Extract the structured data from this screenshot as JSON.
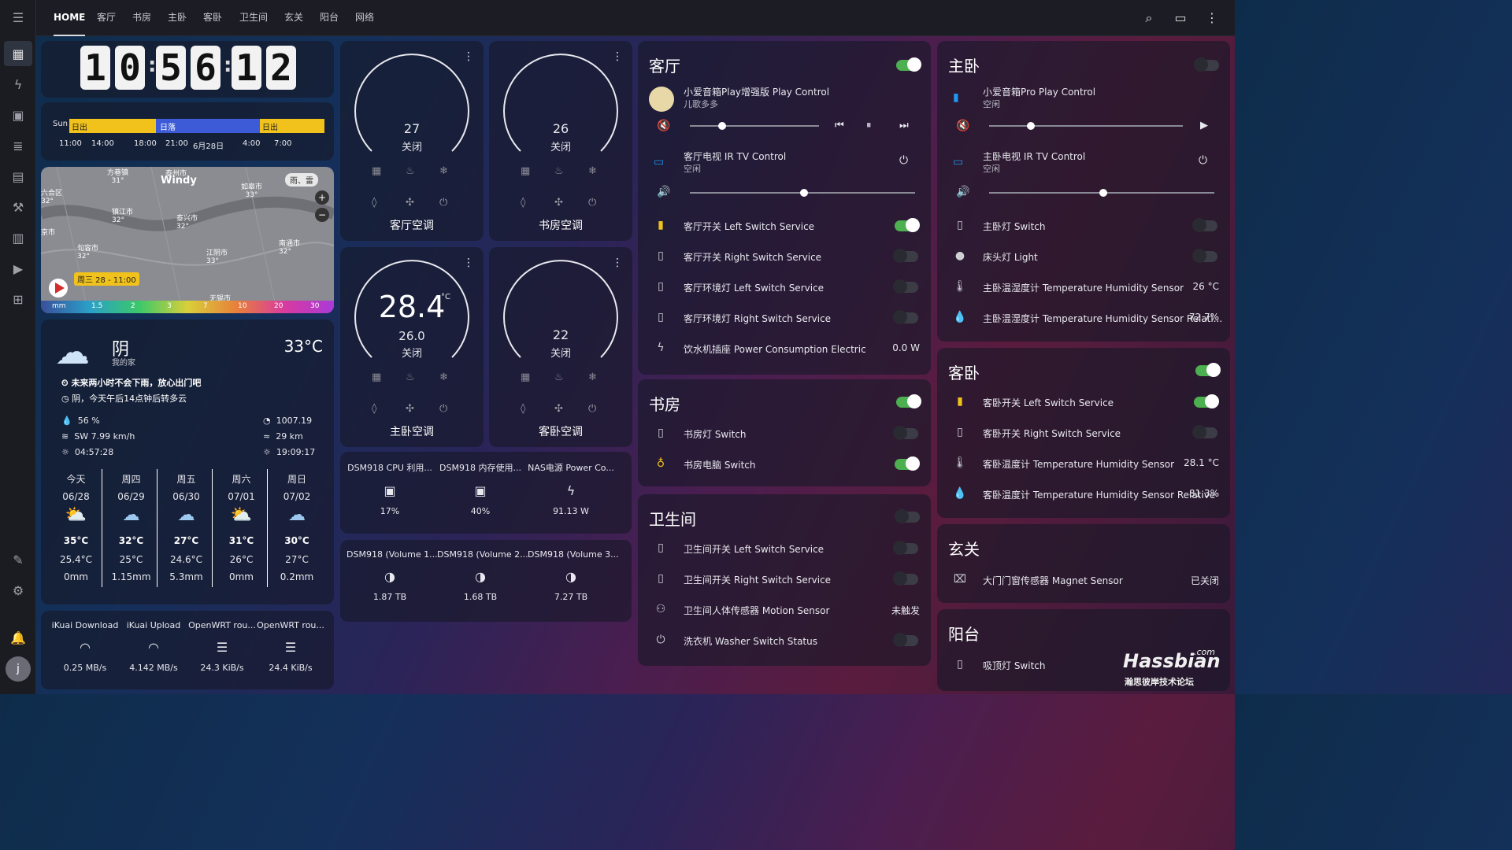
{
  "header": {
    "tabs": [
      "HOME",
      "客厅",
      "书房",
      "主卧",
      "客卧",
      "卫生间",
      "玄关",
      "阳台",
      "网络"
    ]
  },
  "clock": {
    "digits": [
      "1",
      "0",
      "5",
      "6",
      "1",
      "2"
    ]
  },
  "sun": {
    "day": "Sun",
    "seg1": "日出",
    "seg2": "日落",
    "seg3": "日出",
    "times": [
      "11:00",
      "14:00",
      "18:00",
      "21:00",
      "6月28日",
      "4:00",
      "7:00"
    ]
  },
  "map": {
    "brand": "Windy",
    "rain": "雨、雷",
    "time_badge": "周三 28 - 11:00",
    "scale_unit": "mm",
    "scale": [
      "1.5",
      "2",
      "3",
      "7",
      "10",
      "20",
      "30"
    ],
    "places": [
      {
        "n": "方巷镇",
        "t": "31°"
      },
      {
        "n": "泰州市",
        "t": ""
      },
      {
        "n": "如皋市",
        "t": "33°"
      },
      {
        "n": "六合区",
        "t": "32°"
      },
      {
        "n": "镇江市",
        "t": "32°"
      },
      {
        "n": "泰兴市",
        "t": "32°"
      },
      {
        "n": "句容市",
        "t": "32°"
      },
      {
        "n": "江阴市",
        "t": "33°"
      },
      {
        "n": "南通市",
        "t": "32°"
      },
      {
        "n": "无锡市",
        "t": ""
      },
      {
        "n": "京市",
        "t": ""
      }
    ]
  },
  "weather": {
    "cond": "阴",
    "loc": "我的家",
    "temp": "33°C",
    "alert1": "未来两小时不会下雨，放心出门吧",
    "alert2": "阴，今天午后14点钟后转多云",
    "humidity": "56 %",
    "wind": "SW 7.99 km/h",
    "sunrise": "04:57:28",
    "pressure": "1007.19",
    "visibility": "29 km",
    "sunset": "19:09:17",
    "forecast": [
      {
        "d": "今天",
        "date": "06/28",
        "hi": "35°C",
        "lo": "25.4°C",
        "rain": "0mm"
      },
      {
        "d": "周四",
        "date": "06/29",
        "hi": "32°C",
        "lo": "25°C",
        "rain": "1.15mm"
      },
      {
        "d": "周五",
        "date": "06/30",
        "hi": "27°C",
        "lo": "24.6°C",
        "rain": "5.3mm"
      },
      {
        "d": "周六",
        "date": "07/01",
        "hi": "31°C",
        "lo": "26°C",
        "rain": "0mm"
      },
      {
        "d": "周日",
        "date": "07/02",
        "hi": "30°C",
        "lo": "27°C",
        "rain": "0.2mm"
      }
    ]
  },
  "net": [
    {
      "n": "iKuai Download",
      "v": "0.25 MB/s"
    },
    {
      "n": "iKuai Upload",
      "v": "4.142 MB/s"
    },
    {
      "n": "OpenWRT rou...",
      "v": "24.3 KiB/s"
    },
    {
      "n": "OpenWRT rou...",
      "v": "24.4 KiB/s"
    }
  ],
  "ac": [
    {
      "name": "客厅空调",
      "set": "27",
      "state": "关闭",
      "cur": ""
    },
    {
      "name": "书房空调",
      "set": "26",
      "state": "关闭",
      "cur": ""
    },
    {
      "name": "主卧空调",
      "set": "26.0",
      "state": "关闭",
      "cur": "28.4",
      "unit": "°C"
    },
    {
      "name": "客卧空调",
      "set": "22",
      "state": "关闭",
      "cur": ""
    }
  ],
  "nas1": [
    {
      "n": "DSM918 CPU 利用...",
      "v": "17%"
    },
    {
      "n": "DSM918 内存使用...",
      "v": "40%"
    },
    {
      "n": "NAS电源 Power Co...",
      "v": "91.13 W"
    }
  ],
  "nas2": [
    {
      "n": "DSM918 (Volume 1...",
      "v": "1.87 TB"
    },
    {
      "n": "DSM918 (Volume 2...",
      "v": "1.68 TB"
    },
    {
      "n": "DSM918 (Volume 3...",
      "v": "7.27 TB"
    }
  ],
  "living": {
    "title": "客厅",
    "media_name": "小爱音箱Play增强版 Play Control",
    "media_sub": "儿歌多多",
    "tv_name": "客厅电视 IR TV Control",
    "tv_sub": "空闲",
    "rows": [
      {
        "n": "客厅开关 Left Switch Service",
        "v": ""
      },
      {
        "n": "客厅开关 Right Switch Service",
        "v": ""
      },
      {
        "n": "客厅环境灯 Left Switch Service",
        "v": ""
      },
      {
        "n": "客厅环境灯 Right Switch Service",
        "v": ""
      },
      {
        "n": "饮水机插座 Power Consumption Electric",
        "v": "0.0 W"
      }
    ]
  },
  "study": {
    "title": "书房",
    "rows": [
      {
        "n": "书房灯 Switch"
      },
      {
        "n": "书房电脑 Switch"
      }
    ]
  },
  "bath": {
    "title": "卫生间",
    "rows": [
      {
        "n": "卫生间开关 Left Switch Service",
        "v": ""
      },
      {
        "n": "卫生间开关 Right Switch Service",
        "v": ""
      },
      {
        "n": "卫生间人体传感器 Motion Sensor",
        "v": "未触发"
      },
      {
        "n": "洗衣机 Washer Switch Status",
        "v": ""
      }
    ]
  },
  "master": {
    "title": "主卧",
    "media_name": "小爱音箱Pro Play Control",
    "media_sub": "空闲",
    "tv_name": "主卧电视 IR TV Control",
    "tv_sub": "空闲",
    "rows": [
      {
        "n": "主卧灯 Switch",
        "v": ""
      },
      {
        "n": "床头灯 Light",
        "v": ""
      },
      {
        "n": "主卧温湿度计 Temperature Humidity Sensor",
        "v": "26 °C"
      },
      {
        "n": "主卧温湿度计 Temperature Humidity Sensor Relati...",
        "v": "72.7%"
      }
    ]
  },
  "guest": {
    "title": "客卧",
    "rows": [
      {
        "n": "客卧开关 Left Switch Service",
        "v": ""
      },
      {
        "n": "客卧开关 Right Switch Service",
        "v": ""
      },
      {
        "n": "客卧温度计 Temperature Humidity Sensor",
        "v": "28.1 °C"
      },
      {
        "n": "客卧温度计 Temperature Humidity Sensor Relative",
        "v": "81.3%"
      }
    ]
  },
  "entry": {
    "title": "玄关",
    "row": "大门门窗传感器 Magnet Sensor",
    "val": "已关闭"
  },
  "balcony": {
    "title": "阳台",
    "row": "吸顶灯 Switch"
  },
  "watermark": {
    "text": "Hassbian",
    "com": ".com",
    "sub": "瀚思彼岸技术论坛"
  },
  "avatar": "j",
  "colors": {
    "toggle_on": "#4caf50",
    "sun_yellow": "#f1c21b",
    "sun_blue": "#3d5bd6",
    "accent_blue": "#2196f3"
  }
}
